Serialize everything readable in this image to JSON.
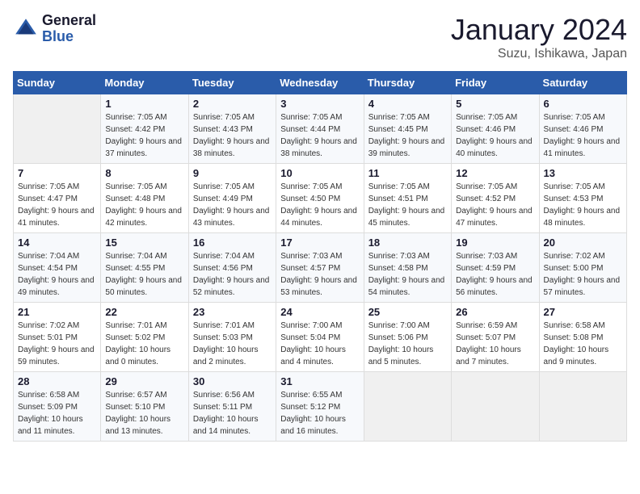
{
  "header": {
    "logo_line1": "General",
    "logo_line2": "Blue",
    "title": "January 2024",
    "subtitle": "Suzu, Ishikawa, Japan"
  },
  "weekdays": [
    "Sunday",
    "Monday",
    "Tuesday",
    "Wednesday",
    "Thursday",
    "Friday",
    "Saturday"
  ],
  "weeks": [
    [
      {
        "day": "",
        "sunrise": "",
        "sunset": "",
        "daylight": ""
      },
      {
        "day": "1",
        "sunrise": "Sunrise: 7:05 AM",
        "sunset": "Sunset: 4:42 PM",
        "daylight": "Daylight: 9 hours and 37 minutes."
      },
      {
        "day": "2",
        "sunrise": "Sunrise: 7:05 AM",
        "sunset": "Sunset: 4:43 PM",
        "daylight": "Daylight: 9 hours and 38 minutes."
      },
      {
        "day": "3",
        "sunrise": "Sunrise: 7:05 AM",
        "sunset": "Sunset: 4:44 PM",
        "daylight": "Daylight: 9 hours and 38 minutes."
      },
      {
        "day": "4",
        "sunrise": "Sunrise: 7:05 AM",
        "sunset": "Sunset: 4:45 PM",
        "daylight": "Daylight: 9 hours and 39 minutes."
      },
      {
        "day": "5",
        "sunrise": "Sunrise: 7:05 AM",
        "sunset": "Sunset: 4:46 PM",
        "daylight": "Daylight: 9 hours and 40 minutes."
      },
      {
        "day": "6",
        "sunrise": "Sunrise: 7:05 AM",
        "sunset": "Sunset: 4:46 PM",
        "daylight": "Daylight: 9 hours and 41 minutes."
      }
    ],
    [
      {
        "day": "7",
        "sunrise": "Sunrise: 7:05 AM",
        "sunset": "Sunset: 4:47 PM",
        "daylight": "Daylight: 9 hours and 41 minutes."
      },
      {
        "day": "8",
        "sunrise": "Sunrise: 7:05 AM",
        "sunset": "Sunset: 4:48 PM",
        "daylight": "Daylight: 9 hours and 42 minutes."
      },
      {
        "day": "9",
        "sunrise": "Sunrise: 7:05 AM",
        "sunset": "Sunset: 4:49 PM",
        "daylight": "Daylight: 9 hours and 43 minutes."
      },
      {
        "day": "10",
        "sunrise": "Sunrise: 7:05 AM",
        "sunset": "Sunset: 4:50 PM",
        "daylight": "Daylight: 9 hours and 44 minutes."
      },
      {
        "day": "11",
        "sunrise": "Sunrise: 7:05 AM",
        "sunset": "Sunset: 4:51 PM",
        "daylight": "Daylight: 9 hours and 45 minutes."
      },
      {
        "day": "12",
        "sunrise": "Sunrise: 7:05 AM",
        "sunset": "Sunset: 4:52 PM",
        "daylight": "Daylight: 9 hours and 47 minutes."
      },
      {
        "day": "13",
        "sunrise": "Sunrise: 7:05 AM",
        "sunset": "Sunset: 4:53 PM",
        "daylight": "Daylight: 9 hours and 48 minutes."
      }
    ],
    [
      {
        "day": "14",
        "sunrise": "Sunrise: 7:04 AM",
        "sunset": "Sunset: 4:54 PM",
        "daylight": "Daylight: 9 hours and 49 minutes."
      },
      {
        "day": "15",
        "sunrise": "Sunrise: 7:04 AM",
        "sunset": "Sunset: 4:55 PM",
        "daylight": "Daylight: 9 hours and 50 minutes."
      },
      {
        "day": "16",
        "sunrise": "Sunrise: 7:04 AM",
        "sunset": "Sunset: 4:56 PM",
        "daylight": "Daylight: 9 hours and 52 minutes."
      },
      {
        "day": "17",
        "sunrise": "Sunrise: 7:03 AM",
        "sunset": "Sunset: 4:57 PM",
        "daylight": "Daylight: 9 hours and 53 minutes."
      },
      {
        "day": "18",
        "sunrise": "Sunrise: 7:03 AM",
        "sunset": "Sunset: 4:58 PM",
        "daylight": "Daylight: 9 hours and 54 minutes."
      },
      {
        "day": "19",
        "sunrise": "Sunrise: 7:03 AM",
        "sunset": "Sunset: 4:59 PM",
        "daylight": "Daylight: 9 hours and 56 minutes."
      },
      {
        "day": "20",
        "sunrise": "Sunrise: 7:02 AM",
        "sunset": "Sunset: 5:00 PM",
        "daylight": "Daylight: 9 hours and 57 minutes."
      }
    ],
    [
      {
        "day": "21",
        "sunrise": "Sunrise: 7:02 AM",
        "sunset": "Sunset: 5:01 PM",
        "daylight": "Daylight: 9 hours and 59 minutes."
      },
      {
        "day": "22",
        "sunrise": "Sunrise: 7:01 AM",
        "sunset": "Sunset: 5:02 PM",
        "daylight": "Daylight: 10 hours and 0 minutes."
      },
      {
        "day": "23",
        "sunrise": "Sunrise: 7:01 AM",
        "sunset": "Sunset: 5:03 PM",
        "daylight": "Daylight: 10 hours and 2 minutes."
      },
      {
        "day": "24",
        "sunrise": "Sunrise: 7:00 AM",
        "sunset": "Sunset: 5:04 PM",
        "daylight": "Daylight: 10 hours and 4 minutes."
      },
      {
        "day": "25",
        "sunrise": "Sunrise: 7:00 AM",
        "sunset": "Sunset: 5:06 PM",
        "daylight": "Daylight: 10 hours and 5 minutes."
      },
      {
        "day": "26",
        "sunrise": "Sunrise: 6:59 AM",
        "sunset": "Sunset: 5:07 PM",
        "daylight": "Daylight: 10 hours and 7 minutes."
      },
      {
        "day": "27",
        "sunrise": "Sunrise: 6:58 AM",
        "sunset": "Sunset: 5:08 PM",
        "daylight": "Daylight: 10 hours and 9 minutes."
      }
    ],
    [
      {
        "day": "28",
        "sunrise": "Sunrise: 6:58 AM",
        "sunset": "Sunset: 5:09 PM",
        "daylight": "Daylight: 10 hours and 11 minutes."
      },
      {
        "day": "29",
        "sunrise": "Sunrise: 6:57 AM",
        "sunset": "Sunset: 5:10 PM",
        "daylight": "Daylight: 10 hours and 13 minutes."
      },
      {
        "day": "30",
        "sunrise": "Sunrise: 6:56 AM",
        "sunset": "Sunset: 5:11 PM",
        "daylight": "Daylight: 10 hours and 14 minutes."
      },
      {
        "day": "31",
        "sunrise": "Sunrise: 6:55 AM",
        "sunset": "Sunset: 5:12 PM",
        "daylight": "Daylight: 10 hours and 16 minutes."
      },
      {
        "day": "",
        "sunrise": "",
        "sunset": "",
        "daylight": ""
      },
      {
        "day": "",
        "sunrise": "",
        "sunset": "",
        "daylight": ""
      },
      {
        "day": "",
        "sunrise": "",
        "sunset": "",
        "daylight": ""
      }
    ]
  ]
}
